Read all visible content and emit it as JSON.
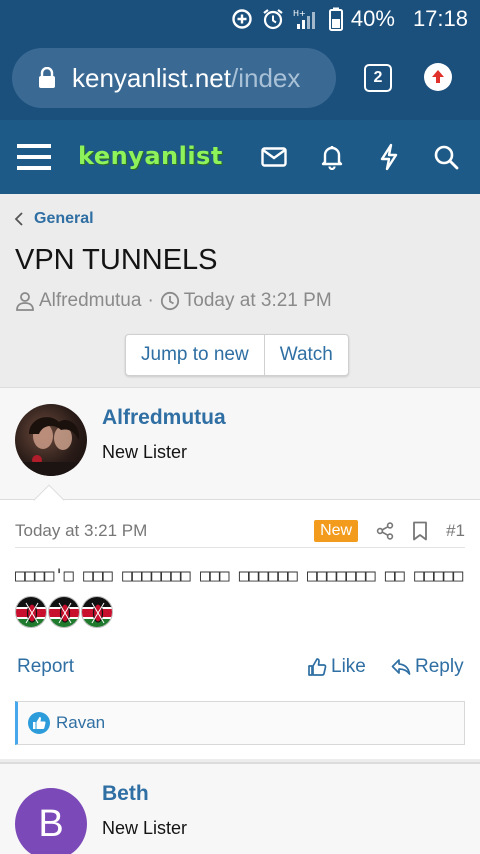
{
  "status_bar": {
    "battery": "40%",
    "time": "17:18",
    "network": "H+"
  },
  "browser": {
    "url_host": "kenyanlist.net",
    "url_path": "/index",
    "tab_count": "2"
  },
  "site": {
    "logo_text": "kenyanlist",
    "brand_color": "#1e5a87",
    "logo_color": "#8ef25b"
  },
  "breadcrumb": {
    "label": "General"
  },
  "thread": {
    "title": "VPN TUNNELS",
    "author": "Alfredmutua",
    "date": "Today at 3:21 PM"
  },
  "buttons": {
    "jump_to_new": "Jump to new",
    "watch": "Watch"
  },
  "post1": {
    "username": "Alfredmutua",
    "user_title": "New Lister",
    "date": "Today at 3:21 PM",
    "badge": "New",
    "post_number": "#1",
    "body": "□□□□'□ □□□ □□□□□□□ □□□ □□□□□□ □□□□□□□ □□ □□□□□",
    "flag_count": 3,
    "report_label": "Report",
    "like_label": "Like",
    "reply_label": "Reply",
    "reaction_user": "Ravan"
  },
  "post2": {
    "username": "Beth",
    "user_title": "New Lister",
    "avatar_letter": "B"
  }
}
